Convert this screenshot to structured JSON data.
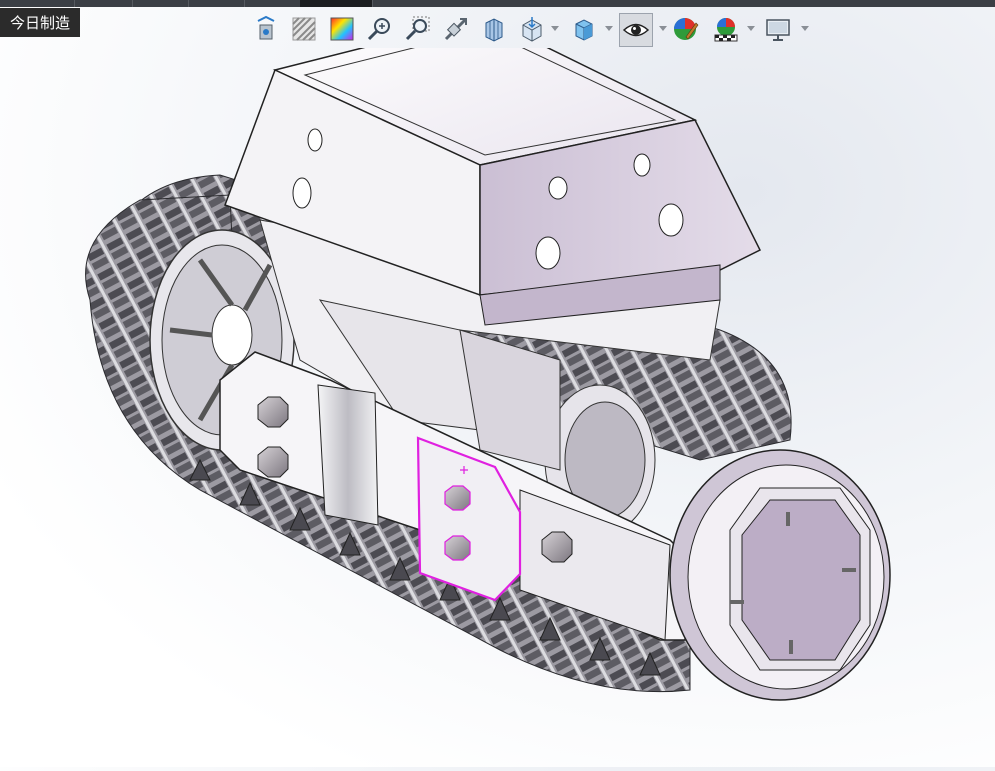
{
  "app": {
    "watermark": "今日制造"
  },
  "toolbar": {
    "items": [
      {
        "name": "view-settings-icon",
        "has_dropdown": false
      },
      {
        "name": "section-view-icon",
        "has_dropdown": false
      },
      {
        "name": "appearance-icon",
        "has_dropdown": false
      },
      {
        "name": "zoom-to-fit-icon",
        "has_dropdown": false
      },
      {
        "name": "zoom-to-area-icon",
        "has_dropdown": false
      },
      {
        "name": "previous-view-icon",
        "has_dropdown": false
      },
      {
        "name": "section-plane-icon",
        "has_dropdown": false
      },
      {
        "name": "view-orientation-icon",
        "has_dropdown": true
      },
      {
        "name": "display-style-icon",
        "has_dropdown": true
      },
      {
        "name": "hide-show-items-icon",
        "has_dropdown": true
      },
      {
        "name": "edit-appearance-icon",
        "has_dropdown": false
      },
      {
        "name": "apply-scene-icon",
        "has_dropdown": true
      },
      {
        "name": "view-setting-monitor-icon",
        "has_dropdown": true
      }
    ],
    "active_item": "hide-show-items-icon"
  },
  "viewport": {
    "model": "tracked-robot-chassis-assembly",
    "selection_color": "#e020e0",
    "part_color": "#c9bfd0",
    "track_color": "#55545a"
  }
}
